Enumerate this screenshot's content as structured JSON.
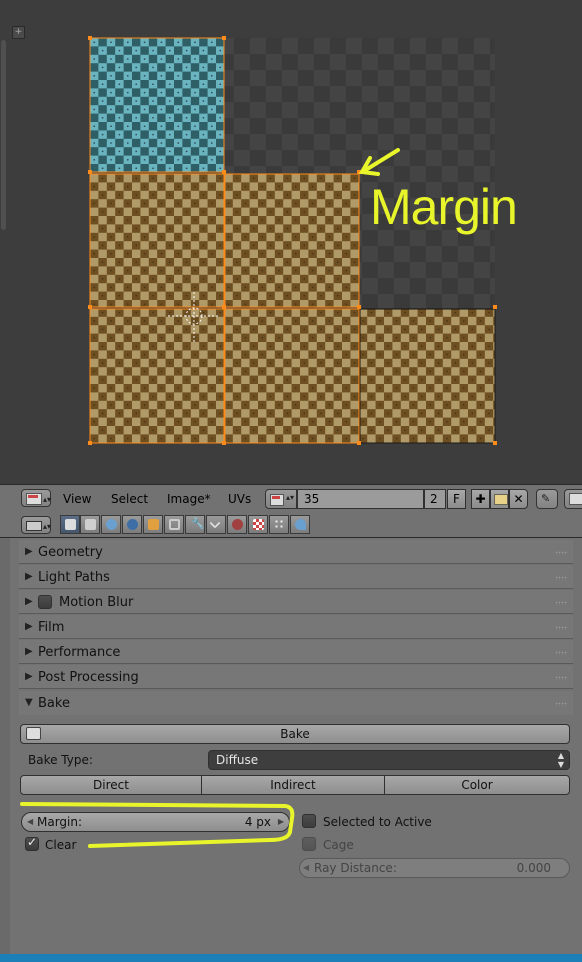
{
  "viewport": {
    "annotation_text": "Margin",
    "annotation_color": "#e8f52a"
  },
  "image_header": {
    "menus": [
      "View",
      "Select",
      "Image*",
      "UVs"
    ],
    "image_name": "35",
    "user_count": "2",
    "fake_user": "F",
    "icons": [
      "editor-type-icon",
      "image-browse-icon",
      "new-image-icon",
      "open-image-icon",
      "unlink-image-icon",
      "pin-icon"
    ]
  },
  "properties_header": {
    "tabs": [
      "render-tab",
      "render-layers-tab",
      "scene-tab",
      "world-tab",
      "object-tab",
      "constraints-tab",
      "modifiers-tab",
      "data-tab",
      "material-tab",
      "texture-tab",
      "particles-tab",
      "physics-tab"
    ],
    "active_tab": "render-tab"
  },
  "panels": [
    {
      "label": "Geometry",
      "collapsed": true
    },
    {
      "label": "Light Paths",
      "collapsed": true
    },
    {
      "label": "Motion Blur",
      "collapsed": true,
      "has_checkbox": true
    },
    {
      "label": "Film",
      "collapsed": true
    },
    {
      "label": "Performance",
      "collapsed": true
    },
    {
      "label": "Post Processing",
      "collapsed": true
    },
    {
      "label": "Bake",
      "collapsed": false
    }
  ],
  "bake": {
    "bake_button": "Bake",
    "bake_type_label": "Bake Type:",
    "bake_type_value": "Diffuse",
    "pass_buttons": [
      "Direct",
      "Indirect",
      "Color"
    ],
    "margin_label": "Margin:",
    "margin_value": "4 px",
    "clear_label": "Clear",
    "clear_checked": true,
    "selected_to_active_label": "Selected to Active",
    "selected_to_active_checked": false,
    "cage_label": "Cage",
    "ray_distance_label": "Ray Distance:",
    "ray_distance_value": "0.000"
  },
  "colors": {
    "highlight": "#e8f52a",
    "selection_orange": "#ff8c1a",
    "active_tab": "#5a6e88"
  }
}
